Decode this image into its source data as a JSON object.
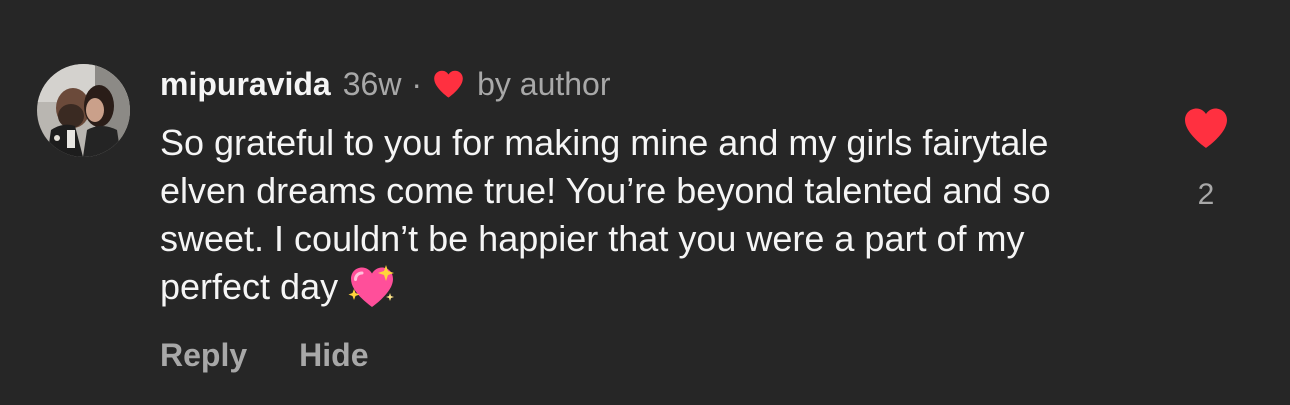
{
  "comment": {
    "username": "mipuravida",
    "time_ago": "36w",
    "separator": "·",
    "author_like_label": "by author",
    "text": "So grateful to you for making mine and my girls fairytale elven dreams come true! You’re beyond talented and so sweet. I couldn’t be happier that you were a part of my perfect day",
    "emoji": "sparkling-heart",
    "like_count": "2"
  },
  "actions": {
    "reply_label": "Reply",
    "hide_label": "Hide"
  },
  "icons": {
    "avatar": "avatar-photo",
    "author_heart": "heart-icon",
    "like": "heart-icon"
  },
  "colors": {
    "background": "#262626",
    "primary_text": "#f5f5f5",
    "secondary_text": "#a8a8a8",
    "heart": "#ff3040",
    "emoji_pink": "#ff4f9a"
  }
}
